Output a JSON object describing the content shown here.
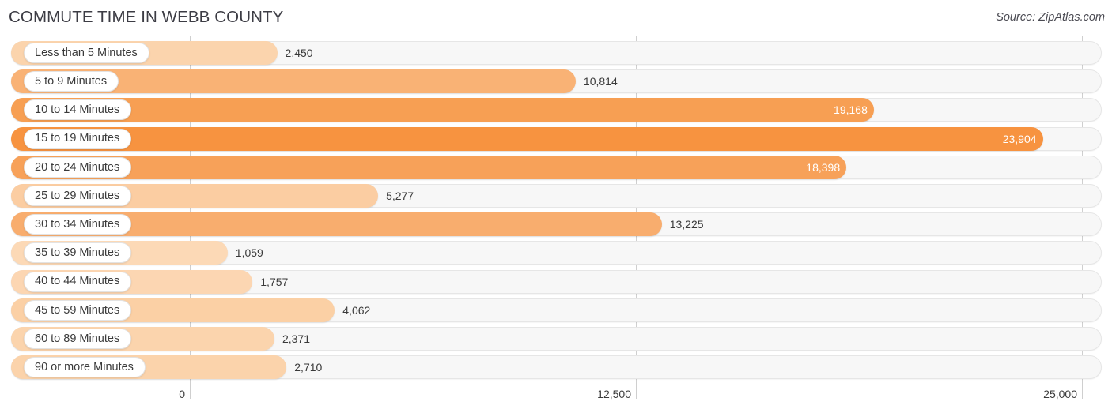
{
  "header": {
    "title": "COMMUTE TIME IN WEBB COUNTY",
    "source": "Source: ZipAtlas.com"
  },
  "chart_data": {
    "type": "bar",
    "orientation": "horizontal",
    "title": "COMMUTE TIME IN WEBB COUNTY",
    "xlabel": "",
    "ylabel": "",
    "xlim": [
      0,
      25000
    ],
    "grid": true,
    "legend": false,
    "tick_labels": [
      "0",
      "12,500",
      "25,000"
    ],
    "ticks": [
      0,
      12500,
      25000
    ],
    "categories": [
      "Less than 5 Minutes",
      "5 to 9 Minutes",
      "10 to 14 Minutes",
      "15 to 19 Minutes",
      "20 to 24 Minutes",
      "25 to 29 Minutes",
      "30 to 34 Minutes",
      "35 to 39 Minutes",
      "40 to 44 Minutes",
      "45 to 59 Minutes",
      "60 to 89 Minutes",
      "90 or more Minutes"
    ],
    "values": [
      2450,
      10814,
      19168,
      23904,
      18398,
      5277,
      13225,
      1059,
      1757,
      4062,
      2371,
      2710
    ],
    "value_labels": [
      "2,450",
      "10,814",
      "19,168",
      "23,904",
      "18,398",
      "5,277",
      "13,225",
      "1,059",
      "1,757",
      "4,062",
      "2,371",
      "2,710"
    ],
    "label_inside": [
      false,
      false,
      true,
      true,
      true,
      false,
      false,
      false,
      false,
      false,
      false,
      false
    ],
    "bar_colors": [
      "#fbd4ad",
      "#f9b275",
      "#f79f53",
      "#f79340",
      "#f7a159",
      "#fbcda2",
      "#f8ad6e",
      "#fcd9b6",
      "#fcd6b2",
      "#fbd0a5",
      "#fbd4ad",
      "#fbd3ab"
    ]
  },
  "colors": {
    "accent": "#f7a159",
    "track": "#f7f7f7",
    "grid": "#cfcfcf",
    "text": "#3a3a3a"
  }
}
